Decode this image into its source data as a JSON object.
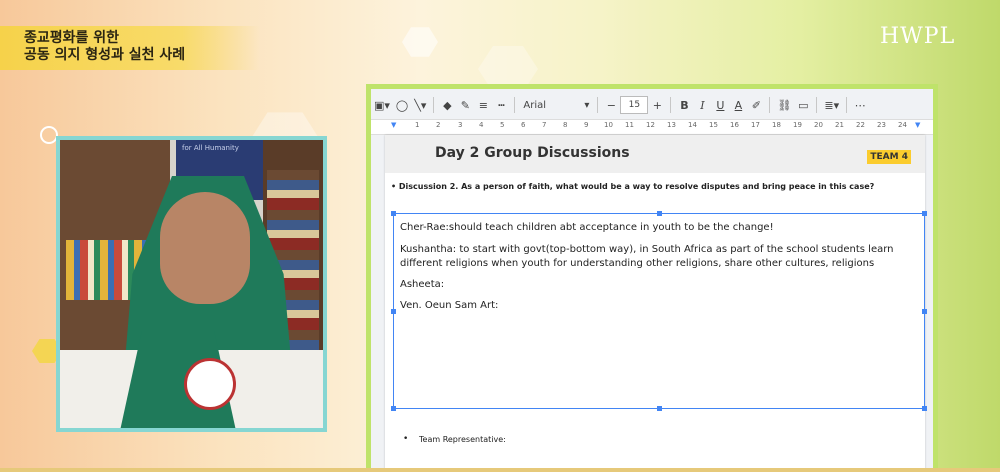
{
  "brand": "HWPL",
  "caption": {
    "line1": "종교평화를 위한",
    "line2": "공동 의지 형성과 실천 사례"
  },
  "video": {
    "poster_text": "for All Humanity"
  },
  "toolbar": {
    "font_name": "Arial",
    "font_size": "15",
    "bold_label": "B",
    "italic_label": "I",
    "underline_label": "U",
    "text_color_label": "A"
  },
  "ruler": {
    "ticks": [
      "1",
      "2",
      "3",
      "4",
      "5",
      "6",
      "7",
      "8",
      "9",
      "10",
      "11",
      "12",
      "13",
      "14",
      "15",
      "16",
      "17",
      "18",
      "19",
      "20",
      "21",
      "22",
      "23",
      "24"
    ]
  },
  "document": {
    "title": "Day 2 Group Discussions",
    "team_badge": "TEAM 4",
    "question": "• Discussion 2. As a person of faith, what would be a way to resolve disputes and bring peace in this case?",
    "lines": [
      "Cher-Rae:should teach children abt acceptance in youth to be the change!",
      "Kushantha:    to start with govt(top-bottom way), in South Africa as part of the school students learn",
      "different religions when youth for understanding other religions, share other cultures, religions",
      "Asheeta:",
      "Ven. Oeun Sam Art:"
    ],
    "team_representative": "Team Representative:"
  },
  "colors": {
    "accent_blue": "#4285f4",
    "team_badge_bg": "#fbcc2e",
    "frame_green": "#bfe36a",
    "video_frame": "#86d6d2",
    "caption_band": "#f6d24a"
  }
}
